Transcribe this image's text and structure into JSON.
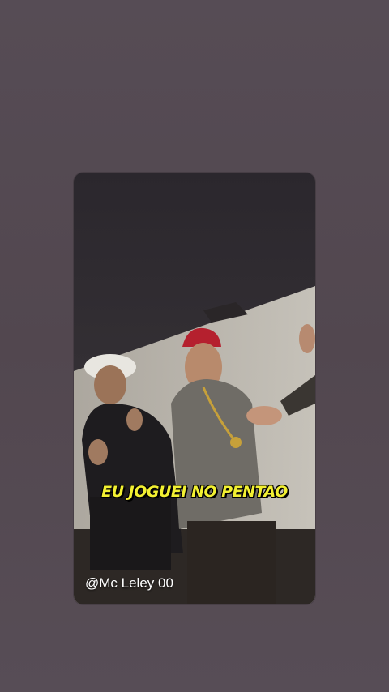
{
  "colors": {
    "background": "#534a52",
    "caption": "#f2f032"
  },
  "story": {
    "caption": "EU JOGUEI NO PENTAO",
    "username": "@Mc Leley 00"
  }
}
